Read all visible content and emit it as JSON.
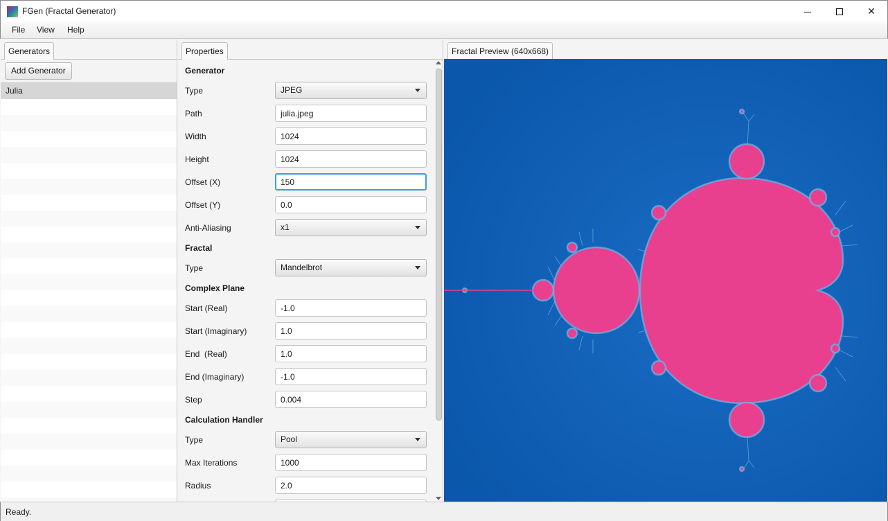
{
  "window": {
    "title": "FGen (Fractal Generator)"
  },
  "menu": [
    "File",
    "View",
    "Help"
  ],
  "left": {
    "tab": "Generators",
    "add_button": "Add Generator",
    "items": [
      "Julia"
    ]
  },
  "middle": {
    "tab": "Properties",
    "sections": {
      "generator": "Generator",
      "fractal": "Fractal",
      "complex_plane": "Complex Plane",
      "calc_handler": "Calculation Handler"
    },
    "fields": {
      "gen_type": {
        "label": "Type",
        "value": "JPEG"
      },
      "path": {
        "label": "Path",
        "value": "julia.jpeg"
      },
      "width": {
        "label": "Width",
        "value": "1024"
      },
      "height": {
        "label": "Height",
        "value": "1024"
      },
      "offset_x": {
        "label": "Offset (X)",
        "value": "150"
      },
      "offset_y": {
        "label": "Offset (Y)",
        "value": "0.0"
      },
      "anti_aliasing": {
        "label": "Anti-Aliasing",
        "value": "x1"
      },
      "fractal_type": {
        "label": "Type",
        "value": "Mandelbrot"
      },
      "start_real": {
        "label": "Start (Real)",
        "value": "-1.0"
      },
      "start_imag": {
        "label": "Start (Imaginary)",
        "value": "1.0"
      },
      "end_real": {
        "label": "End  (Real)",
        "value": "1.0"
      },
      "end_imag": {
        "label": "End (Imaginary)",
        "value": "-1.0"
      },
      "step": {
        "label": "Step",
        "value": "0.004"
      },
      "calc_type": {
        "label": "Type",
        "value": "Pool"
      },
      "max_iter": {
        "label": "Max Iterations",
        "value": "1000"
      },
      "radius": {
        "label": "Radius",
        "value": "2.0"
      }
    }
  },
  "right": {
    "tab": "Fractal Preview (640x668)",
    "colors": {
      "background": "#0b5ab0",
      "set": "#e8408f",
      "fringe": "#7fc4ee"
    }
  },
  "status": "Ready."
}
